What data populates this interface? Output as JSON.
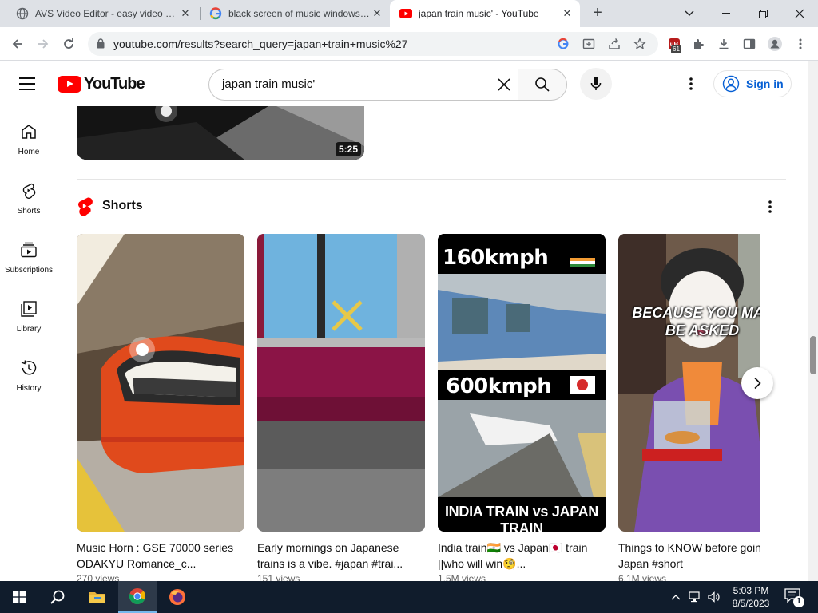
{
  "browser": {
    "tabs": [
      {
        "title": "AVS Video Editor - easy video editing",
        "close": "✕"
      },
      {
        "title": "black screen of music windows media",
        "close": "✕"
      },
      {
        "title": "japan train music' - YouTube",
        "close": "✕"
      }
    ],
    "new_tab": "+",
    "url": "youtube.com/results?search_query=japan+train+music%27",
    "extension_badge": "61"
  },
  "youtube": {
    "logo_text": "YouTube",
    "search_value": "japan train music'",
    "sign_in": "Sign in",
    "sidebar": [
      {
        "label": "Home",
        "icon": "home-icon"
      },
      {
        "label": "Shorts",
        "icon": "shorts-icon"
      },
      {
        "label": "Subscriptions",
        "icon": "subscriptions-icon"
      },
      {
        "label": "Library",
        "icon": "library-icon"
      },
      {
        "label": "History",
        "icon": "history-icon"
      }
    ],
    "previous_video": {
      "duration": "5:25"
    },
    "shorts_section": {
      "title": "Shorts",
      "items": [
        {
          "title": "Music Horn : GSE 70000 series ODAKYU Romance_c...",
          "views": "270 views"
        },
        {
          "title": "Early mornings on Japanese trains is a vibe. #japan #trai...",
          "views": "151 views"
        },
        {
          "title": "India train🇮🇳 vs Japan🇯🇵 train ||who will win🧐...",
          "views": "1.5M views",
          "overlay_top": "160kmph",
          "overlay_mid": "600kmph",
          "overlay_bottom": "INDIA TRAIN vs JAPAN TRAIN"
        },
        {
          "title": "Things to KNOW before going to Japan #short",
          "views": "6.1M views",
          "overlay_line1": "BECAUSE YOU MAY",
          "overlay_line2": "BE ASKED"
        }
      ]
    }
  },
  "taskbar": {
    "time": "5:03 PM",
    "date": "8/5/2023",
    "notifications": "1"
  },
  "colors": {
    "youtube_red": "#ff0000",
    "link_blue": "#065fd4",
    "taskbar": "#101c2c"
  }
}
